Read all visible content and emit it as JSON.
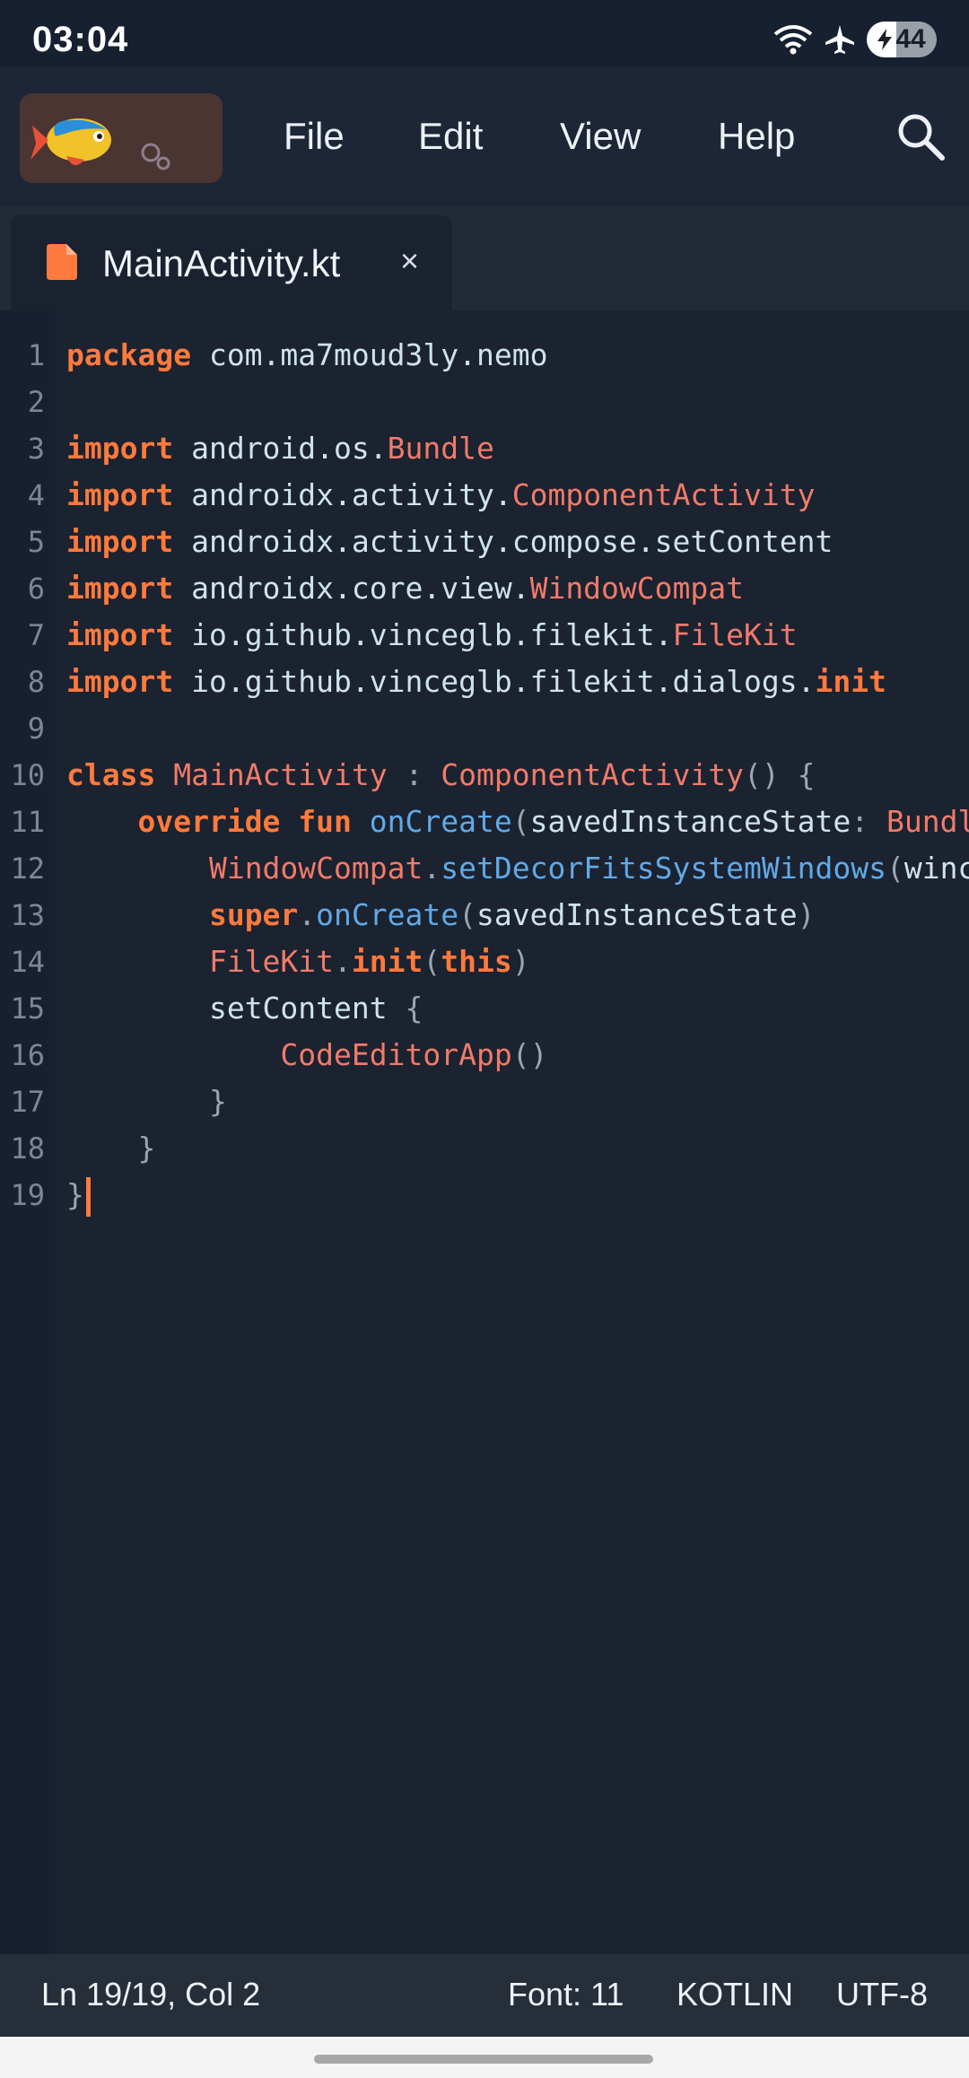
{
  "status_bar": {
    "time": "03:04",
    "battery": "44",
    "icons": [
      "wifi-icon",
      "airplane-icon",
      "battery-icon"
    ]
  },
  "app_bar": {
    "logo": "fish-logo",
    "menu": [
      "File",
      "Edit",
      "View",
      "Help"
    ],
    "search_icon": "search-icon"
  },
  "tabs": [
    {
      "title": "MainActivity.kt",
      "icon": "file-icon",
      "close": "×"
    }
  ],
  "editor": {
    "lines": [
      {
        "n": "1",
        "tokens": [
          {
            "t": "package",
            "c": "kw"
          },
          {
            "t": " com.ma7moud3ly.nemo",
            "c": "pl"
          }
        ]
      },
      {
        "n": "2",
        "tokens": []
      },
      {
        "n": "3",
        "tokens": [
          {
            "t": "import",
            "c": "kw"
          },
          {
            "t": " android.os.",
            "c": "pl"
          },
          {
            "t": "Bundle",
            "c": "ty"
          }
        ]
      },
      {
        "n": "4",
        "tokens": [
          {
            "t": "import",
            "c": "kw"
          },
          {
            "t": " androidx.activity.",
            "c": "pl"
          },
          {
            "t": "ComponentActivity",
            "c": "ty"
          }
        ]
      },
      {
        "n": "5",
        "tokens": [
          {
            "t": "import",
            "c": "kw"
          },
          {
            "t": " androidx.activity.compose.setContent",
            "c": "pl"
          }
        ]
      },
      {
        "n": "6",
        "tokens": [
          {
            "t": "import",
            "c": "kw"
          },
          {
            "t": " androidx.core.view.",
            "c": "pl"
          },
          {
            "t": "WindowCompat",
            "c": "ty"
          }
        ]
      },
      {
        "n": "7",
        "tokens": [
          {
            "t": "import",
            "c": "kw"
          },
          {
            "t": " io.github.vinceglb.filekit.",
            "c": "pl"
          },
          {
            "t": "FileKit",
            "c": "ty"
          }
        ]
      },
      {
        "n": "8",
        "tokens": [
          {
            "t": "import",
            "c": "kw"
          },
          {
            "t": " io.github.vinceglb.filekit.dialogs.",
            "c": "pl"
          },
          {
            "t": "init",
            "c": "kw"
          }
        ]
      },
      {
        "n": "9",
        "tokens": []
      },
      {
        "n": "10",
        "tokens": [
          {
            "t": "class",
            "c": "kw"
          },
          {
            "t": " ",
            "c": "pl"
          },
          {
            "t": "MainActivity",
            "c": "ty"
          },
          {
            "t": " : ",
            "c": "pu"
          },
          {
            "t": "ComponentActivity",
            "c": "ty"
          },
          {
            "t": "() {",
            "c": "pu"
          }
        ]
      },
      {
        "n": "11",
        "tokens": [
          {
            "t": "    ",
            "c": "pl"
          },
          {
            "t": "override fun",
            "c": "kw"
          },
          {
            "t": " ",
            "c": "pl"
          },
          {
            "t": "onCreate",
            "c": "fn"
          },
          {
            "t": "(",
            "c": "pu"
          },
          {
            "t": "savedInstanceState",
            "c": "pl"
          },
          {
            "t": ": ",
            "c": "pu"
          },
          {
            "t": "Bundl",
            "c": "ty"
          }
        ]
      },
      {
        "n": "12",
        "tokens": [
          {
            "t": "        ",
            "c": "pl"
          },
          {
            "t": "WindowCompat",
            "c": "ty"
          },
          {
            "t": ".",
            "c": "pu"
          },
          {
            "t": "setDecorFitsSystemWindows",
            "c": "fn"
          },
          {
            "t": "(",
            "c": "pu"
          },
          {
            "t": "winc",
            "c": "pl"
          }
        ]
      },
      {
        "n": "13",
        "tokens": [
          {
            "t": "        ",
            "c": "pl"
          },
          {
            "t": "super",
            "c": "kw"
          },
          {
            "t": ".",
            "c": "pu"
          },
          {
            "t": "onCreate",
            "c": "fn"
          },
          {
            "t": "(",
            "c": "pu"
          },
          {
            "t": "savedInstanceState",
            "c": "pl"
          },
          {
            "t": ")",
            "c": "pu"
          }
        ]
      },
      {
        "n": "14",
        "tokens": [
          {
            "t": "        ",
            "c": "pl"
          },
          {
            "t": "FileKit",
            "c": "ty"
          },
          {
            "t": ".",
            "c": "pu"
          },
          {
            "t": "init",
            "c": "kw"
          },
          {
            "t": "(",
            "c": "pu"
          },
          {
            "t": "this",
            "c": "kw"
          },
          {
            "t": ")",
            "c": "pu"
          }
        ]
      },
      {
        "n": "15",
        "tokens": [
          {
            "t": "        ",
            "c": "pl"
          },
          {
            "t": "setContent",
            "c": "pl"
          },
          {
            "t": " {",
            "c": "pu"
          }
        ]
      },
      {
        "n": "16",
        "tokens": [
          {
            "t": "            ",
            "c": "pl"
          },
          {
            "t": "CodeEditorApp",
            "c": "ty"
          },
          {
            "t": "()",
            "c": "pu"
          }
        ]
      },
      {
        "n": "17",
        "tokens": [
          {
            "t": "        ",
            "c": "pl"
          },
          {
            "t": "}",
            "c": "pu"
          }
        ]
      },
      {
        "n": "18",
        "tokens": [
          {
            "t": "    ",
            "c": "pl"
          },
          {
            "t": "}",
            "c": "pu"
          }
        ]
      },
      {
        "n": "19",
        "tokens": [
          {
            "t": "}",
            "c": "pu"
          }
        ],
        "cursor": true
      }
    ]
  },
  "status_footer": {
    "position": "Ln 19/19, Col 2",
    "font": "Font: 11",
    "language": "KOTLIN",
    "encoding": "UTF-8"
  },
  "colors": {
    "keyword": "#ff7a3d",
    "type": "#f07b6a",
    "function": "#61a9e6",
    "plain": "#cfe3ea",
    "background": "#1b2230"
  }
}
